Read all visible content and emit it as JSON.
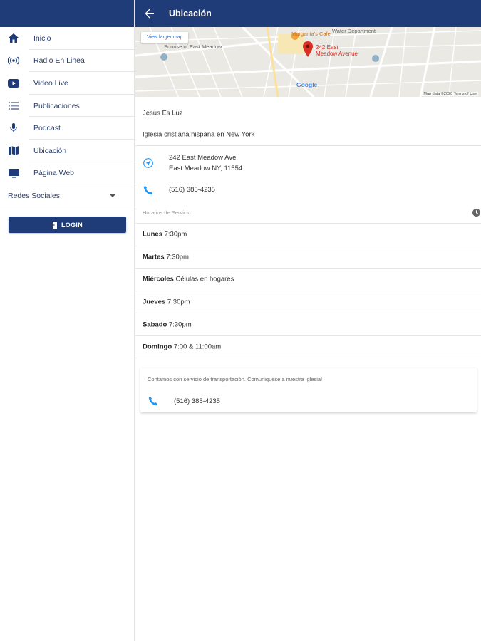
{
  "sidebar": {
    "items": [
      {
        "label": "Inicio",
        "icon": "home-icon"
      },
      {
        "label": "Radio En Linea",
        "icon": "radio-icon"
      },
      {
        "label": "Video Live",
        "icon": "youtube-icon"
      },
      {
        "label": "Publicaciones",
        "icon": "list-icon"
      },
      {
        "label": "Podcast",
        "icon": "microphone-icon"
      },
      {
        "label": "Ubicación",
        "icon": "map-icon"
      },
      {
        "label": "Página Web",
        "icon": "monitor-icon"
      }
    ],
    "redes_label": "Redes Sociales",
    "login_label": "LOGIN"
  },
  "header": {
    "title": "Ubicación"
  },
  "map": {
    "larger_map_label": "View larger map",
    "pin_label_1": "242 East",
    "pin_label_2": "Meadow Avenue",
    "place_1": "Margarita's Cafe",
    "place_2": "Water Department",
    "place_3": "Sunrise of East Meadow",
    "google_label": "Google",
    "credit": "Map data ©2020   Terms of Use"
  },
  "church": {
    "name": "Jesus Es Luz",
    "description": "Iglesia cristiana hispana en New York",
    "address_line1": "242 East Meadow Ave",
    "address_line2": "East Meadow NY, 11554",
    "phone": "(516) 385-4235"
  },
  "schedule": {
    "heading": "Horarios de Servicio",
    "rows": [
      {
        "day": "Lunes",
        "time": "7:30pm"
      },
      {
        "day": "Martes",
        "time": "7:30pm"
      },
      {
        "day": "Miércoles",
        "time": "Células en hogares"
      },
      {
        "day": "Jueves",
        "time": "7:30pm"
      },
      {
        "day": "Sabado",
        "time": "7:30pm"
      },
      {
        "day": "Domingo",
        "time": "7:00 & 11:00am"
      }
    ]
  },
  "transport_card": {
    "note": "Contamos con servicio de transportación. Comuniquese a nuestra iglesia!",
    "phone": "(516) 385-4235"
  },
  "colors": {
    "brand": "#1f3b78",
    "accent": "#2196f3",
    "pin": "#d93025"
  }
}
